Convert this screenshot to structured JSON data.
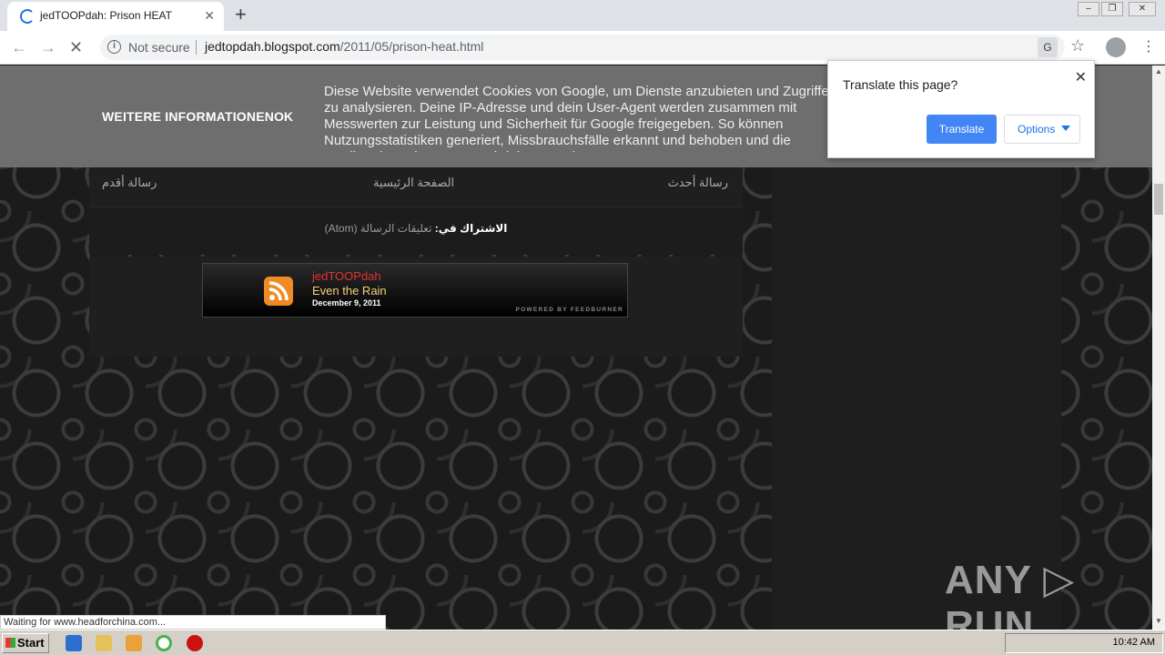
{
  "browser": {
    "tab_title": "jedTOOPdah: Prison HEAT",
    "security_label": "Not secure",
    "url_host": "jedtopdah.blogspot.com",
    "url_path": "/2011/05/prison-heat.html",
    "status_text": "Waiting for www.headforchina.com..."
  },
  "cookie_bar": {
    "more_info": "WEITERE INFORMATIONEN",
    "ok": "OK",
    "message": "Diese Website verwendet Cookies von Google, um Dienste anzubieten und Zugriffe zu analysieren. Deine IP-Adresse und dein User-Agent werden zusammen mit Messwerten zur Leistung und Sicherheit für Google freigegeben. So können Nutzungsstatistiken generiert, Missbrauchsfälle erkannt und behoben und die Qualität des .Dienstes gewährleistet werden"
  },
  "post_nav": {
    "newer": "رسالة أحدث",
    "home": "الصفحة الرئيسية",
    "older": "رسالة أقدم"
  },
  "subscribe": {
    "label": "الاشتراك في:",
    "link": "تعليقات الرسالة (Atom)"
  },
  "feed": {
    "source": "jedTOOPdah",
    "headline": "Even the Rain",
    "date": "December 9, 2011",
    "powered": "POWERED BY FEEDBURNER"
  },
  "translate_popup": {
    "question": "Translate this page?",
    "translate_button": "Translate",
    "options_button": "Options"
  },
  "watermark": "ANY ▷ RUN",
  "taskbar": {
    "start": "Start",
    "clock": "10:42 AM"
  },
  "colors": {
    "accent_blue": "#4285f4",
    "feed_source_red": "#e03333",
    "feed_headline_gold": "#f3d27a",
    "rss_orange": "#f08a24"
  }
}
